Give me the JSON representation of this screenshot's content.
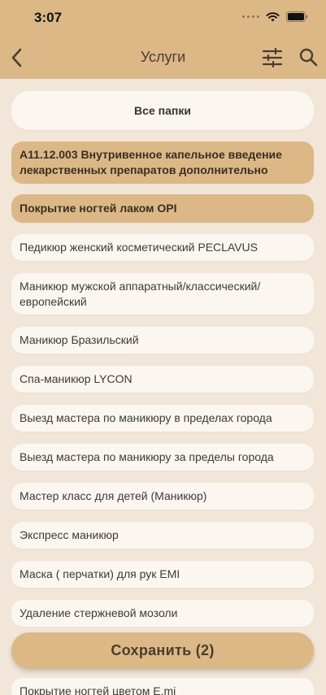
{
  "status_bar": {
    "time": "3:07"
  },
  "nav": {
    "title": "Услуги"
  },
  "folders_button": "Все папки",
  "services": [
    {
      "label": "A11.12.003 Внутривенное капельное введение лекарственных препаратов дополнительно",
      "selected": true
    },
    {
      "label": "Покрытие ногтей лаком OPI",
      "selected": true
    },
    {
      "label": "Педикюр женский косметический PECLAVUS",
      "selected": false
    },
    {
      "label": "Маникюр мужской аппаратный/классический/ европейский",
      "selected": false
    },
    {
      "label": "Маникюр Бразильский",
      "selected": false
    },
    {
      "label": "Спа-маникюр LYCON",
      "selected": false
    },
    {
      "label": "Выезд мастера по маникюру в пределах города",
      "selected": false
    },
    {
      "label": "Выезд мастера по маникюру за пределы города",
      "selected": false
    },
    {
      "label": "Мастер класс для детей (Маникюр)",
      "selected": false
    },
    {
      "label": "Экспресс маникюр",
      "selected": false
    },
    {
      "label": "Маска ( перчатки) для рук EMI",
      "selected": false
    },
    {
      "label": "Удаление стержневой мозоли",
      "selected": false
    },
    {
      "label": "Покрытие ногтей цветом   E.mi",
      "selected": false
    }
  ],
  "save_button": "Сохранить (2)",
  "colors": {
    "accent": "#dcb887",
    "background": "#f1e6d7",
    "pill": "#fbf7f0"
  },
  "icons": {
    "back": "chevron-left-icon",
    "filter": "sliders-icon",
    "search": "search-icon"
  }
}
